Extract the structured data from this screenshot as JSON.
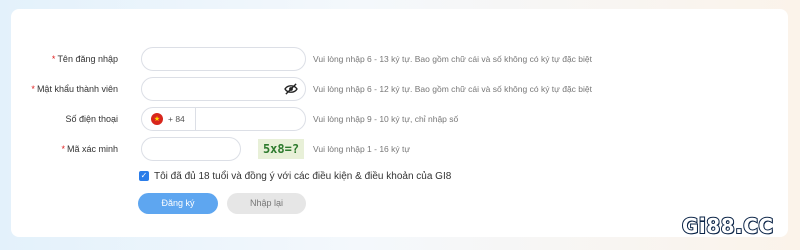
{
  "form": {
    "username": {
      "required_mark": "*",
      "label": "Tên đăng nhập",
      "value": "",
      "hint": "Vui lòng nhập 6 - 13 ký tự. Bao gồm chữ cái và số không có ký tự đặc biệt"
    },
    "password": {
      "required_mark": "*",
      "label": "Mật khẩu thành viên",
      "value": "",
      "toggle_icon": "eye-slash-icon",
      "hint": "Vui lòng nhập 6 - 12 ký tự. Bao gồm chữ cái và số không có ký tự đặc biệt"
    },
    "phone": {
      "label": "Số điện thoại",
      "country_flag_icon": "vietnam-flag-icon",
      "country_code": "+ 84",
      "value": "",
      "hint": "Vui lòng nhập 9 - 10 ký tự, chỉ nhập số"
    },
    "captcha": {
      "required_mark": "*",
      "label": "Mã xác minh",
      "value": "",
      "image_text": "5x8=?",
      "hint": "Vui lòng nhập 1 - 16 ký tự"
    },
    "agreement": {
      "checked": true,
      "text": "Tôi đã đủ 18 tuổi và đồng ý với các điều kiện & điều khoản của GI8"
    },
    "submit_label": "Đăng ký",
    "reset_label": "Nhập lại"
  },
  "brand": {
    "logo_text": "Gi88.CC"
  },
  "colors": {
    "primary": "#5ea6f0",
    "required": "#e02020",
    "checkbox": "#2b7de9",
    "logo_outline": "#0b2447"
  }
}
